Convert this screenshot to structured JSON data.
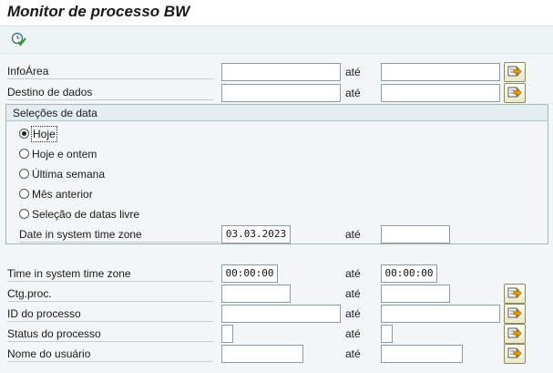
{
  "header": {
    "title": "Monitor de processo BW"
  },
  "toolbar": {
    "execute_icon": "execute-clock-icon"
  },
  "to_label": "até",
  "fields": {
    "infoarea": {
      "label": "InfoÁrea",
      "from": "",
      "to": ""
    },
    "data_target": {
      "label": "Destino de dados",
      "from": "",
      "to": ""
    },
    "time_system_zone": {
      "label": "Time in system time zone",
      "from": "00:00:00",
      "to": "00:00:00"
    },
    "process_category": {
      "label": "Ctg.proc.",
      "from": "",
      "to": ""
    },
    "process_id": {
      "label": "ID do processo",
      "from": "",
      "to": ""
    },
    "process_status": {
      "label": "Status do processo",
      "from": "",
      "to": ""
    },
    "user_name": {
      "label": "Nome do usuário",
      "from": "",
      "to": ""
    }
  },
  "date_group": {
    "title": "Seleções de data",
    "options": [
      {
        "label": "Hoje",
        "selected": true
      },
      {
        "label": "Hoje e ontem",
        "selected": false
      },
      {
        "label": "Última semana",
        "selected": false
      },
      {
        "label": "Mês anterior",
        "selected": false
      },
      {
        "label": "Seleção de datas livre",
        "selected": false
      }
    ],
    "date_field": {
      "label": "Date in system time zone",
      "from": "03.03.2023",
      "to": ""
    }
  },
  "colors": {
    "background": "#f2f6f6",
    "input_border": "#8c9aa3",
    "multiselect_arrow": "#e8a31a"
  }
}
